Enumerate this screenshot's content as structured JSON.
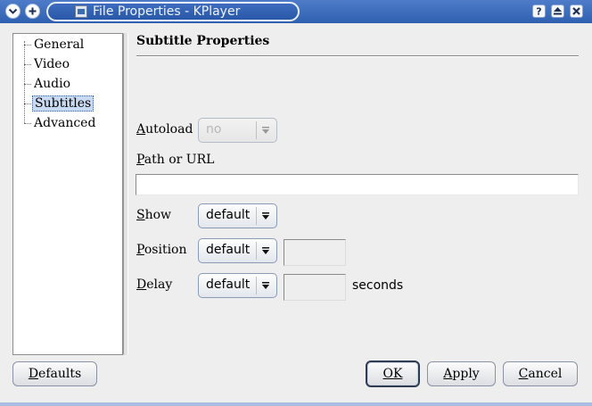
{
  "window": {
    "title": "File Properties - KPlayer"
  },
  "tree": {
    "items": [
      {
        "label": "General"
      },
      {
        "label": "Video"
      },
      {
        "label": "Audio"
      },
      {
        "label": "Subtitles",
        "selected": true
      },
      {
        "label": "Advanced"
      }
    ]
  },
  "panel": {
    "heading": "Subtitle Properties",
    "autoload": {
      "label_mnemonic": "A",
      "label_rest": "utoload",
      "value": "no",
      "enabled": false
    },
    "path": {
      "label_mnemonic": "P",
      "label_rest": "ath or URL",
      "value": ""
    },
    "show": {
      "label_mnemonic": "S",
      "label_rest": "how",
      "value": "default"
    },
    "position": {
      "label_mnemonic": "P",
      "label_rest": "osition",
      "value": "default",
      "field_value": ""
    },
    "delay": {
      "label_mnemonic": "D",
      "label_rest": "elay",
      "value": "default",
      "field_value": "",
      "unit": "seconds"
    }
  },
  "buttons": {
    "defaults": {
      "mnemonic": "D",
      "rest": "efaults"
    },
    "ok": {
      "mnemonic": "O",
      "rest": "K"
    },
    "apply": {
      "mnemonic": "A",
      "rest": "pply"
    },
    "cancel": {
      "mnemonic": "C",
      "rest": "ancel"
    }
  },
  "icons": {
    "menu": "menu-chevron-icon",
    "sticky": "plus-icon",
    "app": "kplayer-icon",
    "help": "help-icon",
    "maximize": "maximize-icon",
    "close": "close-icon",
    "dropdown": "dropdown-arrow-icon"
  },
  "colors": {
    "titlebar": "#2f5fb0",
    "selection": "#c8d9f2"
  }
}
